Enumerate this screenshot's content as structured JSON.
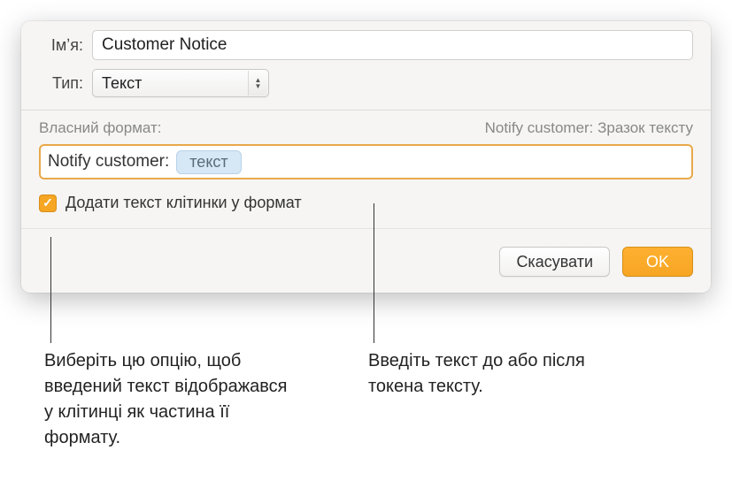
{
  "labels": {
    "name": "Імʼя:",
    "type": "Тип:"
  },
  "fields": {
    "name_value": "Customer Notice",
    "type_value": "Текст"
  },
  "format": {
    "header_left": "Власний формат:",
    "header_right": "Notify customer: Зразок тексту",
    "prefix": "Notify customer:",
    "token": "текст"
  },
  "checkbox": {
    "label": "Додати текст клітинки у формат"
  },
  "buttons": {
    "cancel": "Скасувати",
    "ok": "OK"
  },
  "callouts": {
    "left": "Виберіть цю опцію, щоб введений текст відображався у клітинці як частина її формату.",
    "right": "Введіть текст до або після токена тексту."
  }
}
